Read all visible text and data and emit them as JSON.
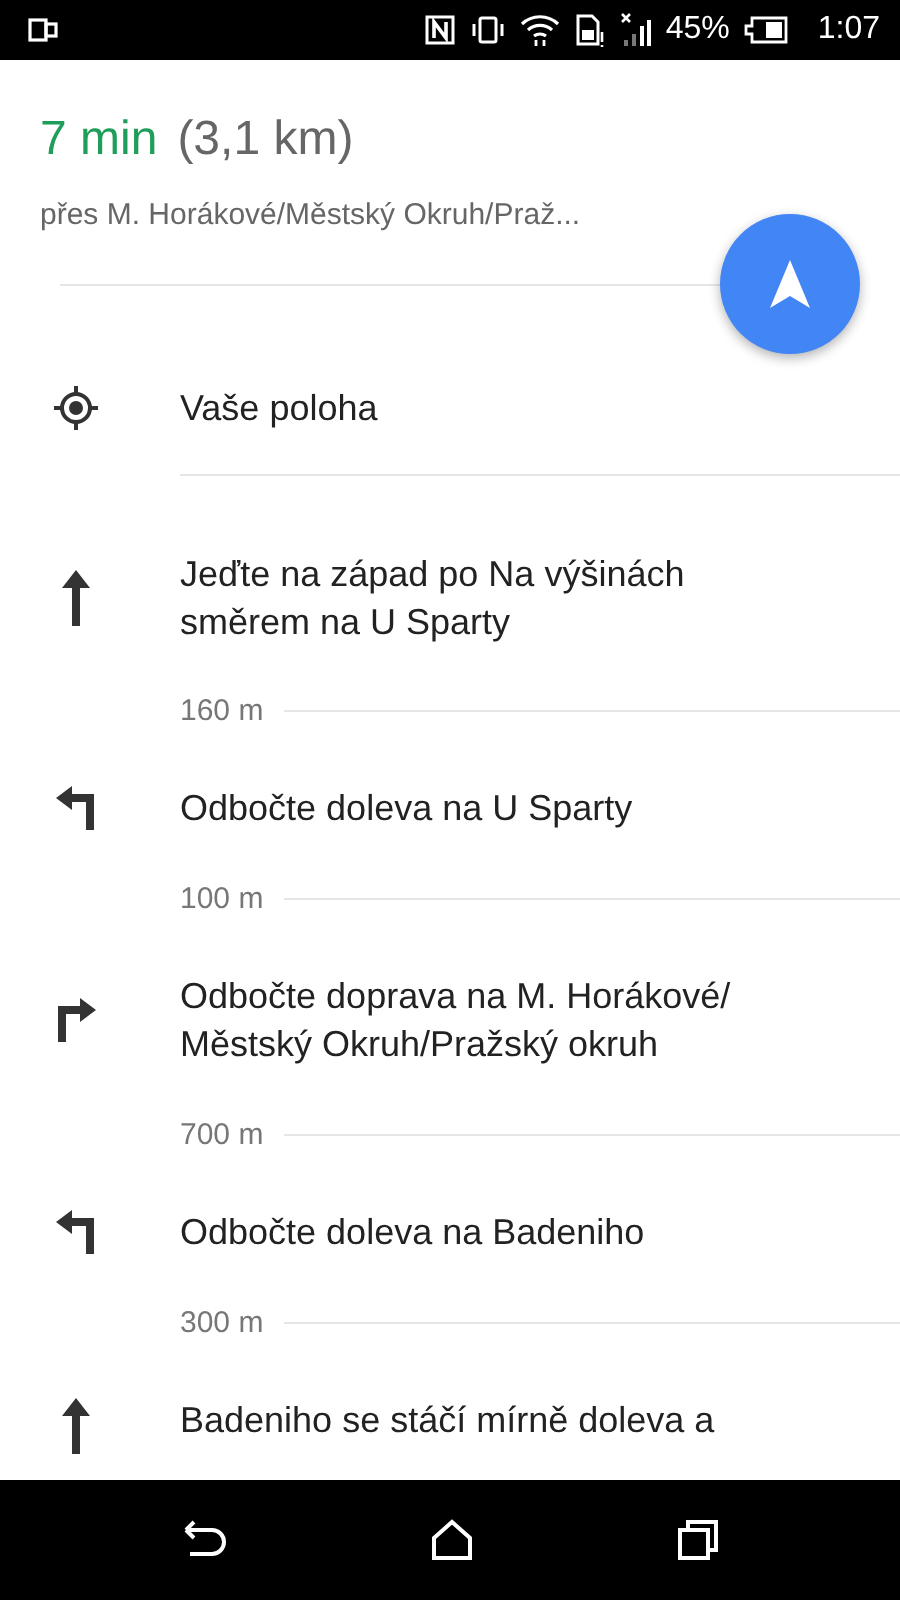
{
  "status_bar": {
    "battery": "45%",
    "time": "1:07"
  },
  "route": {
    "duration": "7 min",
    "distance": "(3,1 km)",
    "via": "přes M. Horákové/Městský Okruh/Praž..."
  },
  "location": {
    "label": "Vaše poloha"
  },
  "steps": [
    {
      "kind": "straight",
      "lines": [
        "Jeďte na západ po Na výšinách",
        "směrem na U Sparty"
      ],
      "distance": "160 m"
    },
    {
      "kind": "left",
      "lines": [
        "Odbočte doleva na U Sparty"
      ],
      "distance": "100 m"
    },
    {
      "kind": "right",
      "lines": [
        "Odbočte doprava na M. Horákové/",
        "Městský Okruh/Pražský okruh"
      ],
      "distance": "700 m"
    },
    {
      "kind": "left",
      "lines": [
        "Odbočte doleva na Badeniho"
      ],
      "distance": "300 m"
    },
    {
      "kind": "straight",
      "lines": [
        "Badeniho se stáčí mírně doleva a"
      ]
    }
  ]
}
